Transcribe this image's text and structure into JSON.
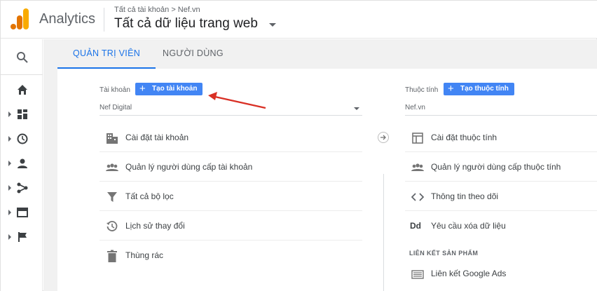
{
  "header": {
    "brand": "Analytics",
    "breadcrumb": "Tất cả tài khoản > Nef.vn",
    "property_title": "Tất cả dữ liệu trang web"
  },
  "tabs": [
    {
      "label": "QUẢN TRỊ VIÊN",
      "active": true
    },
    {
      "label": "NGƯỜI DÙNG",
      "active": false
    }
  ],
  "account_column": {
    "label": "Tài khoản",
    "create_button": "Tạo tài khoản",
    "selected": "Nef Digital",
    "items": [
      {
        "label": "Cài đặt tài khoản",
        "icon": "building-icon"
      },
      {
        "label": "Quản lý người dùng cấp tài khoản",
        "icon": "people-icon"
      },
      {
        "label": "Tất cả bộ lọc",
        "icon": "filter-icon"
      },
      {
        "label": "Lịch sử thay đổi",
        "icon": "history-icon"
      },
      {
        "label": "Thùng rác",
        "icon": "trash-icon"
      }
    ]
  },
  "property_column": {
    "label": "Thuộc tính",
    "create_button": "Tạo thuộc tính",
    "selected": "Nef.vn",
    "items": [
      {
        "label": "Cài đặt thuộc tính",
        "icon": "window-icon"
      },
      {
        "label": "Quản lý người dùng cấp thuộc tính",
        "icon": "people-icon"
      },
      {
        "label": "Thông tin theo dõi",
        "icon": "code-icon"
      },
      {
        "label": "Yêu cầu xóa dữ liệu",
        "icon": "dd-icon"
      }
    ],
    "section_header": "LIÊN KẾT SẢN PHẨM",
    "section_items": [
      {
        "label": "Liên kết Google Ads",
        "icon": "ads-icon"
      }
    ],
    "dd_glyph": "Dd"
  },
  "sidebar": {
    "items": [
      "search-icon",
      "home-icon",
      "dashboard-icon",
      "clock-icon",
      "person-icon",
      "fork-icon",
      "card-icon",
      "flag-icon"
    ]
  },
  "colors": {
    "accent": "#1a73e8",
    "button": "#4285f4",
    "annotation_arrow": "#d93025",
    "logo_orange": "#f9ab00",
    "logo_dark_orange": "#e37400"
  }
}
